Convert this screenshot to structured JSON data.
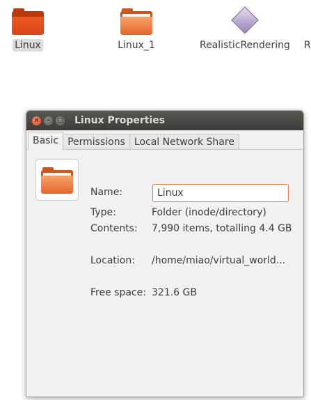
{
  "desktop": {
    "items": [
      {
        "label": "Linux",
        "icon": "folder-icon"
      },
      {
        "label": "Linux_1",
        "icon": "folder-icon"
      },
      {
        "label": "RealisticRendering",
        "icon": "blender-file-icon"
      },
      {
        "label": "R",
        "icon": "file-icon"
      }
    ]
  },
  "dialog": {
    "title": "Linux Properties",
    "tabs": [
      "Basic",
      "Permissions",
      "Local Network Share"
    ],
    "active_tab": "Basic",
    "fields": {
      "name_label": "Name:",
      "name_value": "Linux",
      "type_label": "Type:",
      "type_value": "Folder (inode/directory)",
      "contents_label": "Contents:",
      "contents_value": "7,990 items, totalling 4.4 GB",
      "location_label": "Location:",
      "location_value": "/home/miao/virtual_world...",
      "free_space_label": "Free space:",
      "free_space_value": "321.6 GB"
    },
    "window_buttons": {
      "close": "×",
      "minimize": "–",
      "maximize": "□"
    }
  },
  "colors": {
    "accent": "#e07a4e",
    "folder_red": "#e2491b",
    "folder_orange": "#ef8650",
    "titlebar": "#3e3c38"
  }
}
